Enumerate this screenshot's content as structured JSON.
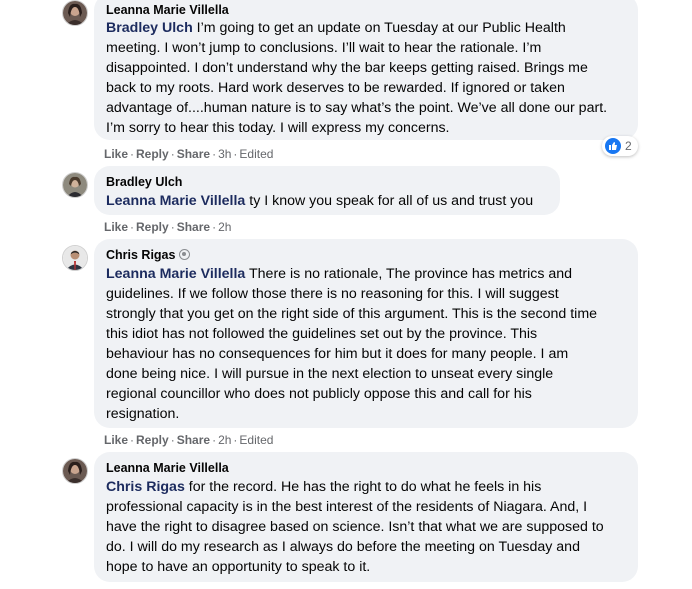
{
  "actions": {
    "like": "Like",
    "reply": "Reply",
    "share": "Share",
    "edited": "Edited"
  },
  "comments": [
    {
      "author": "Leanna Marie Villella",
      "mention": "Bradley Ulch",
      "lines": [
        " I’m going to get an update on Tuesday at our Public Health",
        "meeting. I won’t jump to conclusions. I’ll wait to hear the rationale. I’m",
        "disappointed. I don’t understand why the bar keeps getting raised. Brings me",
        "back to my roots. Hard work deserves to be rewarded. If ignored or taken",
        "advantage of....human nature is to say what’s the point. We’ve all done our part.",
        "I’m sorry to hear this today. I will express my concerns."
      ],
      "time": "3h",
      "reactions_count": "2"
    },
    {
      "author": "Bradley Ulch",
      "mention": "Leanna Marie Villella",
      "lines": [
        " ty I know you speak for all of us and trust you"
      ],
      "time": "2h"
    },
    {
      "author": "Chris Rigas",
      "mention": "Leanna Marie Villella",
      "badge_icon": "top-fan-shield-icon",
      "lines": [
        " There is no rationale, The province has metrics and",
        "guidelines. If we follow those there is no reasoning for this. I will suggest",
        "strongly that you get on the right side of this argument. This is the second time",
        "this idiot has not followed the guidelines set out by the province. This",
        "behaviour has no consequences for him but it does for many people. I am",
        "done being nice. I will pursue in the next election to unseat every single",
        "regional councillor who does not publicly oppose this and call for his",
        "resignation."
      ],
      "time": "2h"
    },
    {
      "author": "Leanna Marie Villella",
      "mention": "Chris Rigas",
      "lines": [
        " for the record. He has the right to do what he feels in his",
        "professional capacity is in the best interest of the residents of Niagara. And, I",
        "have the right to disagree based on science. Isn’t that what we are supposed to",
        "do. I will do my research as I always do before the meeting on Tuesday and",
        "hope to have an opportunity to speak to it."
      ]
    }
  ]
}
